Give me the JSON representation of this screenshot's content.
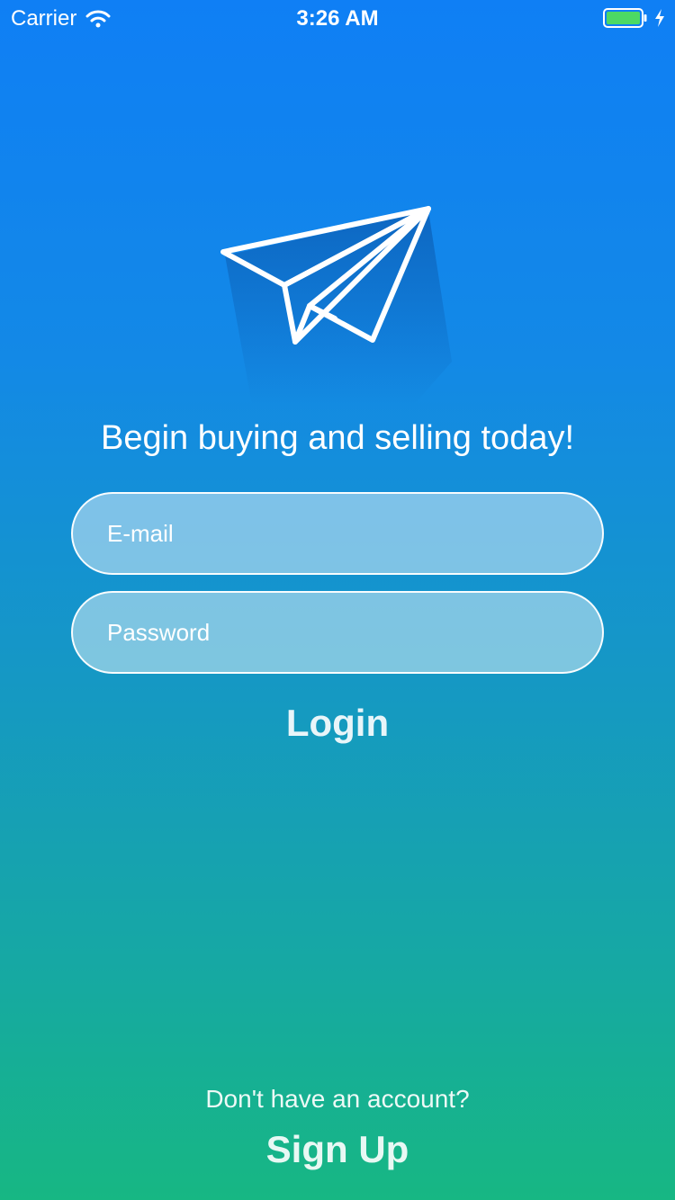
{
  "status_bar": {
    "carrier": "Carrier",
    "time": "3:26 AM",
    "wifi_icon": "wifi-icon",
    "battery_icon": "battery-icon",
    "charging_icon": "charging-bolt-icon"
  },
  "logo": {
    "icon": "paper-plane-icon"
  },
  "tagline": "Begin buying and selling today!",
  "form": {
    "email_placeholder": "E-mail",
    "email_value": "",
    "password_placeholder": "Password",
    "password_value": "",
    "login_label": "Login"
  },
  "footer": {
    "prompt": "Don't have an account?",
    "signup_label": "Sign Up"
  },
  "colors": {
    "gradient_top": "#0f7ff5",
    "gradient_bottom": "#17b783",
    "battery_fill": "#4cd964"
  }
}
